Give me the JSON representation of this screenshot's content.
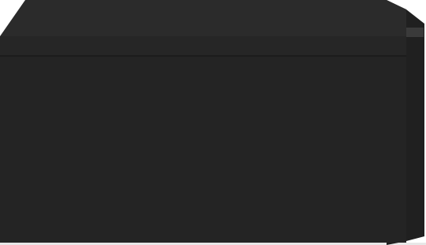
{
  "image": {
    "subject": "black-drawer-unit-icon",
    "colors": {
      "background": "#ffffff",
      "top_surface": "#2b2b2b",
      "front_face": "#242424",
      "front_edge": "#1c1c1c",
      "side_panel": "#1d1d1d",
      "side_ridge": "#2e2e2e",
      "bottom_shadow": "#e7e7e7"
    }
  }
}
